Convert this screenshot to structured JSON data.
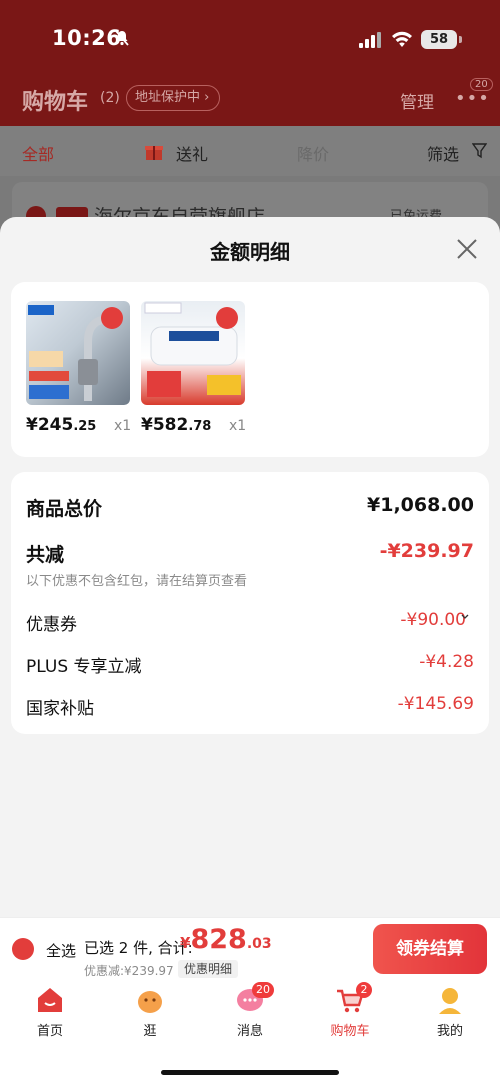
{
  "status_bar": {
    "time": "10:26",
    "battery": "58"
  },
  "nav": {
    "title": "购物车",
    "count": "(2)",
    "address_protect": "地址保护中",
    "manage": "管理",
    "more_badge": "20"
  },
  "tabs": {
    "all": "全部",
    "gift": "送礼",
    "price_drop": "降价",
    "filter": "筛选"
  },
  "store": {
    "name": "海尔京东自营旗舰店",
    "shipping": "已免运费"
  },
  "sheet": {
    "title": "金额明细",
    "products": [
      {
        "price_main": "¥245",
        "price_dec": ".25",
        "qty": "x1"
      },
      {
        "price_main": "¥582",
        "price_dec": ".78",
        "qty": "x1"
      }
    ],
    "total_label": "商品总价",
    "total_value": "¥1,068.00",
    "reduce_label": "共减",
    "reduce_value": "-¥239.97",
    "hint": "以下优惠不包含红包，请在结算页查看",
    "coupon_label": "优惠券",
    "coupon_value": "-¥90.00",
    "plus_label": "PLUS 专享立减",
    "plus_value": "-¥4.28",
    "gov_label": "国家补贴",
    "gov_value": "-¥145.69"
  },
  "checkout": {
    "select_all": "全选",
    "selected_text": "已选 2 件, 合计:",
    "sum_yen": "¥",
    "sum_big": "828",
    "sum_dec": ".03",
    "saved": "优惠减:¥239.97",
    "detail_chip": "优惠明细",
    "pay_button": "领券结算"
  },
  "tabbar": {
    "home": "首页",
    "stroll": "逛",
    "messages": "消息",
    "messages_badge": "20",
    "cart": "购物车",
    "cart_badge": "2",
    "me": "我的"
  },
  "colors": {
    "accent": "#e23d3b",
    "header_bg": "#7a1716"
  }
}
